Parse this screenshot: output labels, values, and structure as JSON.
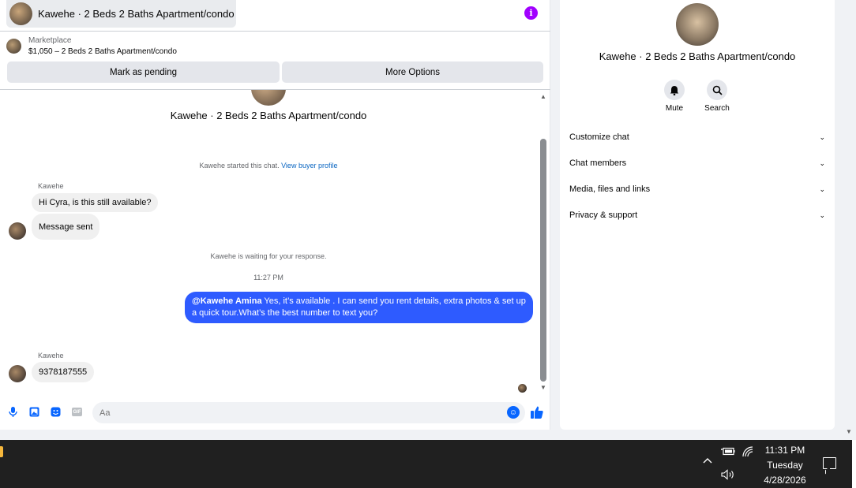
{
  "header": {
    "title": "Kawehe · 2 Beds 2 Baths Apartment/condo",
    "info_icon": "info-icon"
  },
  "marketplace": {
    "label": "Marketplace",
    "listing": "$1,050 – 2 Beds 2 Baths Apartment/condo"
  },
  "actions": {
    "pending_label": "Mark as pending",
    "more_label": "More Options"
  },
  "conversation": {
    "title": "Kawehe · 2 Beds 2 Baths Apartment/condo",
    "started_text": "Kawehe started this chat.",
    "buyer_profile_link": "View buyer profile",
    "sender_name_1": "Kawehe",
    "msg_1": "Hi Cyra, is this still available?",
    "msg_2": "Message sent",
    "waiting_text": "Kawehe is waiting for your response.",
    "timestamp": "11:27 PM",
    "outgoing_mention": "@Kawehe Amina",
    "outgoing_text": " Yes, it’s available .  I can send you rent details, extra photos & set up a quick tour.What’s the best number to text you?",
    "sender_name_2": "Kawehe",
    "msg_3": "9378187555"
  },
  "composer": {
    "placeholder": "Aa",
    "gif_label": "GIF"
  },
  "info_panel": {
    "title": "Kawehe · 2 Beds 2 Baths Apartment/condo",
    "mute_label": "Mute",
    "search_label": "Search",
    "sections": [
      "Customize chat",
      "Chat members",
      "Media, files and links",
      "Privacy & support"
    ]
  },
  "taskbar": {
    "time": "11:31 PM",
    "day": "Tuesday",
    "date": "4/28/2026"
  },
  "colors": {
    "accent": "#0866ff",
    "outgoing_bubble": "#2e5bff",
    "info_purple": "#a100ff"
  }
}
